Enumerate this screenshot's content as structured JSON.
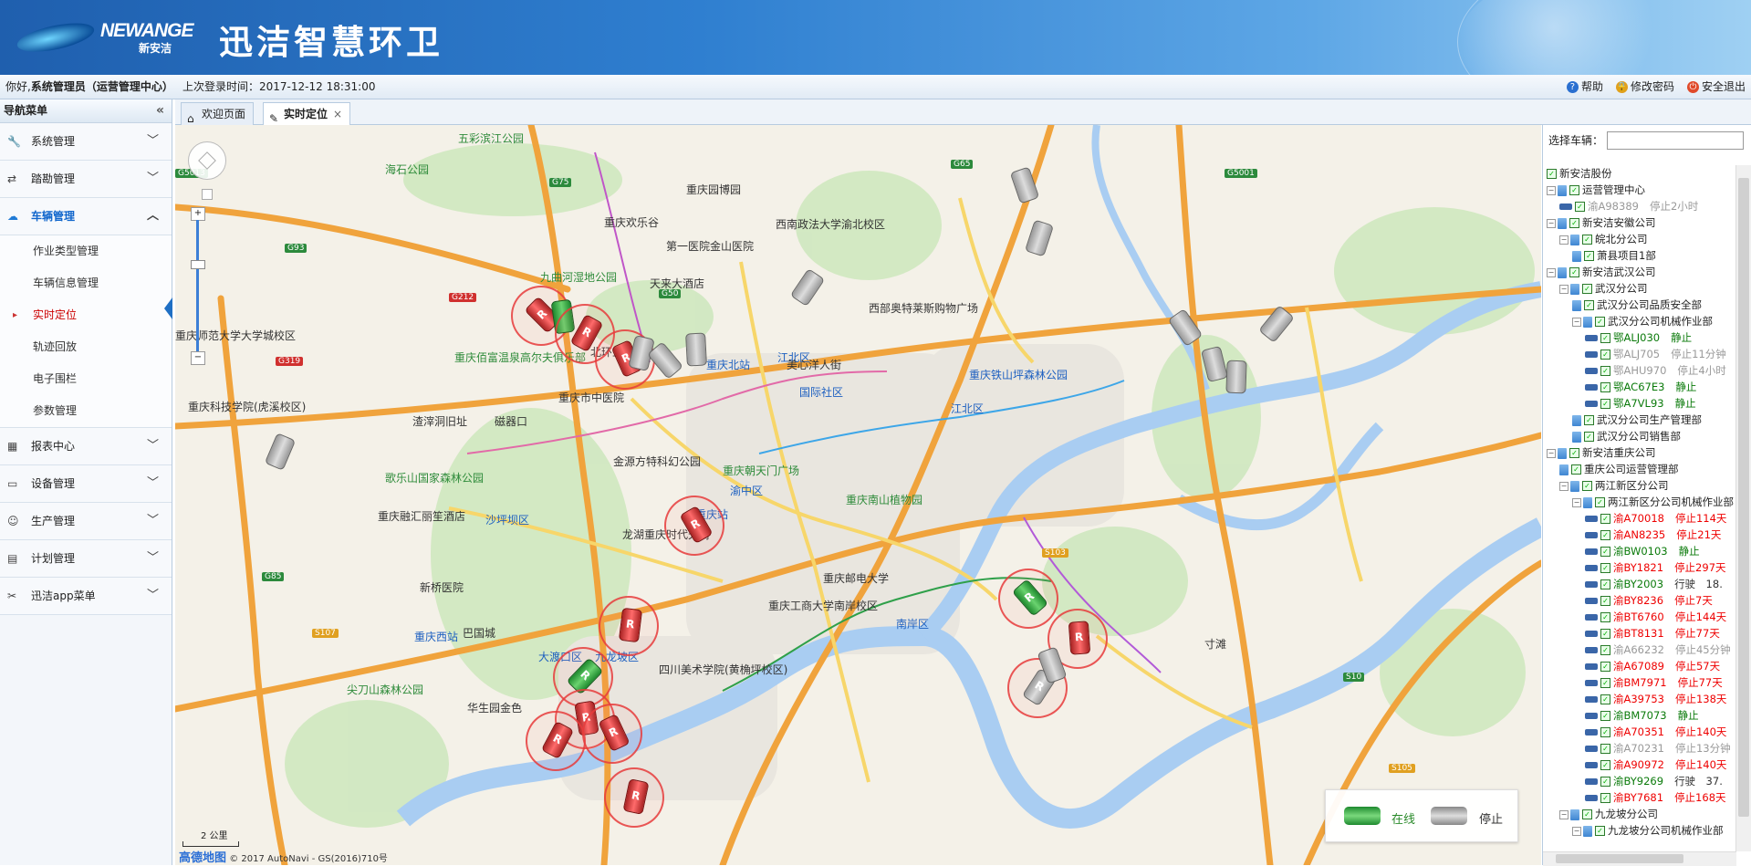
{
  "header": {
    "logo_en": "NEWANGE",
    "logo_cn": "新安洁",
    "title": "迅洁智慧环卫"
  },
  "status": {
    "greeting_prefix": "你好,",
    "user": "系统管理员（运营管理中心）",
    "last_login_label": "上次登录时间：",
    "last_login": "2017-12-12 18:31:00",
    "links": [
      {
        "label": "帮助",
        "icon": "help-icon",
        "color": "#2a6fd0"
      },
      {
        "label": "修改密码",
        "icon": "lock-icon",
        "color": "#e0a020"
      },
      {
        "label": "安全退出",
        "icon": "power-icon",
        "color": "#e04a2a"
      }
    ]
  },
  "sidebar": {
    "title": "导航菜单",
    "collapse": "«",
    "menus": [
      {
        "label": "系统管理",
        "icon": "wrench-icon"
      },
      {
        "label": "踏勘管理",
        "icon": "arrows-icon"
      },
      {
        "label": "车辆管理",
        "icon": "cloud-icon",
        "active": true,
        "children": [
          "作业类型管理",
          "车辆信息管理",
          "实时定位",
          "轨迹回放",
          "电子围栏",
          "参数管理"
        ],
        "current": 2
      },
      {
        "label": "报表中心",
        "icon": "table-icon"
      },
      {
        "label": "设备管理",
        "icon": "monitor-icon"
      },
      {
        "label": "生产管理",
        "icon": "face-icon"
      },
      {
        "label": "计划管理",
        "icon": "document-icon"
      },
      {
        "label": "迅洁app菜单",
        "icon": "app-icon"
      }
    ]
  },
  "tabs": [
    {
      "label": "欢迎页面",
      "icon": "home-icon"
    },
    {
      "label": "实时定位",
      "icon": "locate-icon",
      "active": true,
      "close": "×"
    }
  ],
  "map": {
    "scale": "2 公里",
    "brand": "高德地图",
    "copyright": "© 2017 AutoNavi - GS(2016)710号",
    "legend": {
      "online": "在线",
      "stopped": "停止"
    },
    "labels": [
      "五彩滨江公园",
      "海石公园",
      "重庆欢乐谷",
      "九曲河湿地公园",
      "重庆园博园",
      "西南政法大学渝北校区",
      "天来大酒店",
      "第一医院金山医院",
      "西部奥特莱斯购物广场",
      "重庆师范大学大学城校区",
      "重庆佰富温泉高尔夫俱乐部",
      "北环立交",
      "江北区",
      "重庆北站",
      "美心洋人街",
      "国际社区",
      "重庆铁山坪森林公园",
      "重庆市中医院",
      "金源方特科幻公园",
      "重庆朝天门广场",
      "重庆科技学院(虎溪校区)",
      "渣滓洞旧址",
      "磁器口",
      "歌乐山国家森林公园",
      "重庆融汇丽笙酒店",
      "沙坪坝区",
      "龙湖重庆时代天街",
      "重庆站",
      "渝中区",
      "重庆南山植物园",
      "新桥医院",
      "重庆西站",
      "巴国城",
      "九龙坡区",
      "大渡口区",
      "四川美术学院(黄桷坪校区)",
      "重庆邮电大学",
      "重庆工商大学南岸校区",
      "南岸区",
      "尖刀山森林公园",
      "华生园金色",
      "江北区",
      "寸滩"
    ],
    "roads": [
      "G75",
      "G93",
      "G5013",
      "G212",
      "G319",
      "G50",
      "G65",
      "G5001",
      "S103",
      "G85",
      "S107",
      "S105",
      "S10"
    ],
    "vehicles_on_map": 26
  },
  "rpanel": {
    "select_label": "选择车辆：",
    "tree": [
      {
        "level": 0,
        "type": "org",
        "label": "新安洁股份"
      },
      {
        "level": 0,
        "type": "group",
        "label": "运营管理中心",
        "exp": "−"
      },
      {
        "level": 1,
        "type": "vehicle",
        "plate": "渝A98389",
        "status": "停止2小时",
        "pc": "gray",
        "sc": "gray"
      },
      {
        "level": 0,
        "type": "group",
        "label": "新安洁安徽公司",
        "exp": "−"
      },
      {
        "level": 1,
        "type": "group",
        "label": "皖北分公司",
        "exp": "−"
      },
      {
        "level": 2,
        "type": "group",
        "label": "萧县项目1部"
      },
      {
        "level": 0,
        "type": "group",
        "label": "新安洁武汉公司",
        "exp": "−"
      },
      {
        "level": 1,
        "type": "group",
        "label": "武汉分公司",
        "exp": "−"
      },
      {
        "level": 2,
        "type": "group",
        "label": "武汉分公司品质安全部"
      },
      {
        "level": 2,
        "type": "group",
        "label": "武汉分公司机械作业部",
        "exp": "−"
      },
      {
        "level": 3,
        "type": "vehicle",
        "plate": "鄂ALJ030",
        "status": "静止",
        "pc": "green",
        "sc": "green"
      },
      {
        "level": 3,
        "type": "vehicle",
        "plate": "鄂ALJ705",
        "status": "停止11分钟",
        "pc": "gray",
        "sc": "gray"
      },
      {
        "level": 3,
        "type": "vehicle",
        "plate": "鄂AHU970",
        "status": "停止4小时",
        "pc": "gray",
        "sc": "gray"
      },
      {
        "level": 3,
        "type": "vehicle",
        "plate": "鄂AC67E3",
        "status": "静止",
        "pc": "green",
        "sc": "green"
      },
      {
        "level": 3,
        "type": "vehicle",
        "plate": "鄂A7VL93",
        "status": "静止",
        "pc": "green",
        "sc": "green"
      },
      {
        "level": 2,
        "type": "group",
        "label": "武汉分公司生产管理部"
      },
      {
        "level": 2,
        "type": "group",
        "label": "武汉分公司销售部"
      },
      {
        "level": 0,
        "type": "group",
        "label": "新安洁重庆公司",
        "exp": "−"
      },
      {
        "level": 1,
        "type": "group",
        "label": "重庆公司运营管理部"
      },
      {
        "level": 1,
        "type": "group",
        "label": "两江新区分公司",
        "exp": "−"
      },
      {
        "level": 2,
        "type": "group",
        "label": "两江新区分公司机械作业部",
        "exp": "−"
      },
      {
        "level": 3,
        "type": "vehicle",
        "plate": "渝A70018",
        "status": "停止114天",
        "pc": "red",
        "sc": "red"
      },
      {
        "level": 3,
        "type": "vehicle",
        "plate": "渝AN8235",
        "status": "停止21天",
        "pc": "red",
        "sc": "red"
      },
      {
        "level": 3,
        "type": "vehicle",
        "plate": "渝BW0103",
        "status": "静止",
        "pc": "green",
        "sc": "green"
      },
      {
        "level": 3,
        "type": "vehicle",
        "plate": "渝BY1821",
        "status": "停止297天",
        "pc": "red",
        "sc": "red"
      },
      {
        "level": 3,
        "type": "vehicle",
        "plate": "渝BY2003",
        "status": "行驶　18.",
        "pc": "green",
        "sc": "dark"
      },
      {
        "level": 3,
        "type": "vehicle",
        "plate": "渝BY8236",
        "status": "停止7天",
        "pc": "red",
        "sc": "red"
      },
      {
        "level": 3,
        "type": "vehicle",
        "plate": "渝BT6760",
        "status": "停止144天",
        "pc": "red",
        "sc": "red"
      },
      {
        "level": 3,
        "type": "vehicle",
        "plate": "渝BT8131",
        "status": "停止77天",
        "pc": "red",
        "sc": "red"
      },
      {
        "level": 3,
        "type": "vehicle",
        "plate": "渝A66232",
        "status": "停止45分钟",
        "pc": "gray",
        "sc": "gray"
      },
      {
        "level": 3,
        "type": "vehicle",
        "plate": "渝A67089",
        "status": "停止57天",
        "pc": "red",
        "sc": "red"
      },
      {
        "level": 3,
        "type": "vehicle",
        "plate": "渝BM7971",
        "status": "停止77天",
        "pc": "red",
        "sc": "red"
      },
      {
        "level": 3,
        "type": "vehicle",
        "plate": "渝A39753",
        "status": "停止138天",
        "pc": "red",
        "sc": "red"
      },
      {
        "level": 3,
        "type": "vehicle",
        "plate": "渝BM7073",
        "status": "静止",
        "pc": "green",
        "sc": "green"
      },
      {
        "level": 3,
        "type": "vehicle",
        "plate": "渝A70351",
        "status": "停止140天",
        "pc": "red",
        "sc": "red"
      },
      {
        "level": 3,
        "type": "vehicle",
        "plate": "渝A70231",
        "status": "停止13分钟",
        "pc": "gray",
        "sc": "gray"
      },
      {
        "level": 3,
        "type": "vehicle",
        "plate": "渝A90972",
        "status": "停止140天",
        "pc": "red",
        "sc": "red"
      },
      {
        "level": 3,
        "type": "vehicle",
        "plate": "渝BY9269",
        "status": "行驶　37.",
        "pc": "green",
        "sc": "dark"
      },
      {
        "level": 3,
        "type": "vehicle",
        "plate": "渝BY7681",
        "status": "停止168天",
        "pc": "red",
        "sc": "red"
      },
      {
        "level": 1,
        "type": "group",
        "label": "九龙坡分公司",
        "exp": "−"
      },
      {
        "level": 2,
        "type": "group",
        "label": "九龙坡分公司机械作业部",
        "exp": "−"
      }
    ]
  }
}
